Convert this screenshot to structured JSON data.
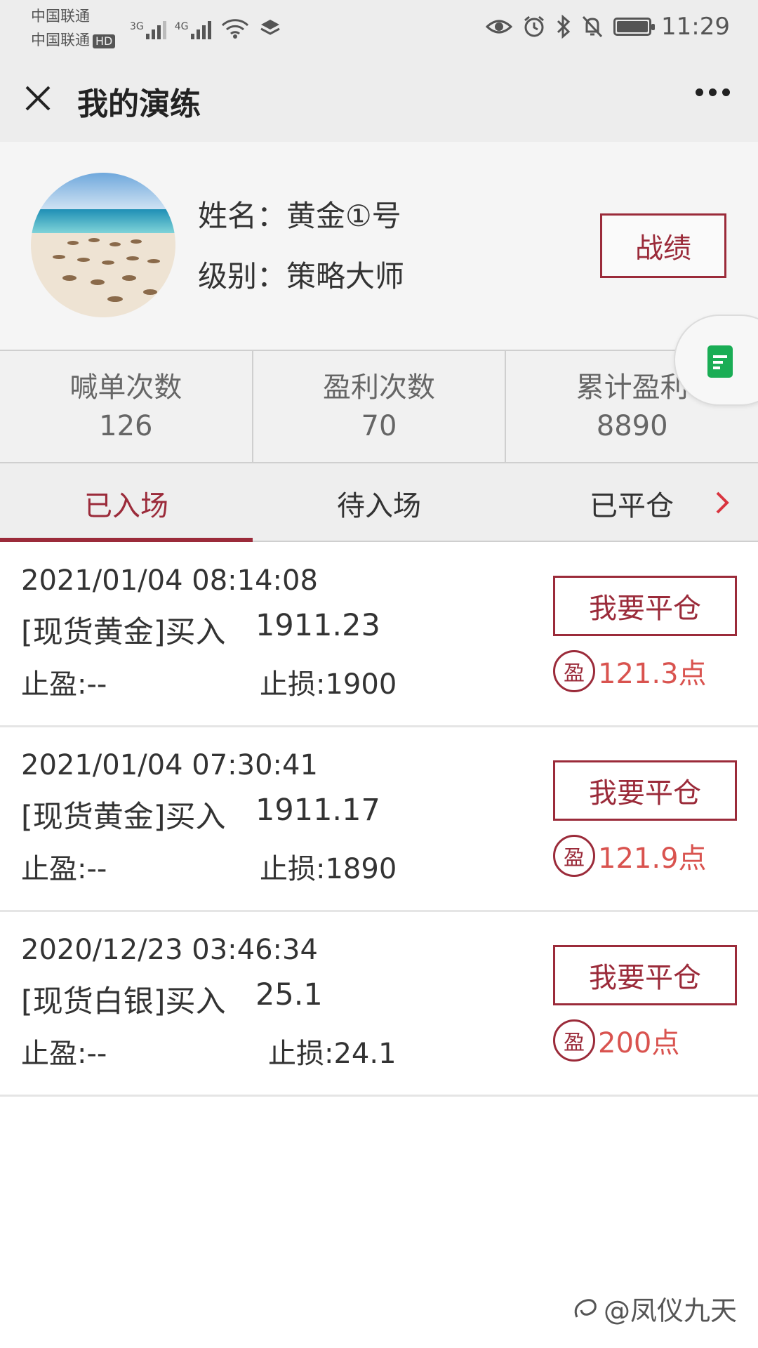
{
  "status_bar": {
    "carrier_1": "中国联通",
    "carrier_2": "中国联通",
    "hd": "HD",
    "net_3g": "3G",
    "net_4g": "4G",
    "time": "11:29"
  },
  "nav": {
    "title": "我的演练"
  },
  "profile": {
    "name_line": "姓名：黄金①号",
    "level_line": "级别：策略大师",
    "record_button": "战绩"
  },
  "stats": [
    {
      "label": "喊单次数",
      "value": "126"
    },
    {
      "label": "盈利次数",
      "value": "70"
    },
    {
      "label": "累计盈利",
      "value": "8890"
    }
  ],
  "tabs": [
    {
      "label": "已入场",
      "active": true
    },
    {
      "label": "待入场",
      "active": false
    },
    {
      "label": "已平仓",
      "active": false
    }
  ],
  "orders": [
    {
      "time": "2021/01/04 08:14:08",
      "product": "[现货黄金]买入",
      "price": "1911.23",
      "take_profit": "止盈:--",
      "stop_loss": "止损:1900",
      "button": "我要平仓",
      "profit_badge": "盈",
      "profit": "121.3点"
    },
    {
      "time": "2021/01/04 07:30:41",
      "product": "[现货黄金]买入",
      "price": "1911.17",
      "take_profit": "止盈:--",
      "stop_loss": "止损:1890",
      "button": "我要平仓",
      "profit_badge": "盈",
      "profit": "121.9点"
    },
    {
      "time": "2020/12/23 03:46:34",
      "product": "[现货白银]买入",
      "price": "25.1",
      "take_profit": "止盈:--",
      "stop_loss": "止损:24.1",
      "button": "我要平仓",
      "profit_badge": "盈",
      "profit": "200点"
    }
  ],
  "watermark": "@凤仪九天",
  "colors": {
    "accent": "#9b2b3a",
    "profit": "#d9534f",
    "wechat_green": "#1aad55"
  }
}
